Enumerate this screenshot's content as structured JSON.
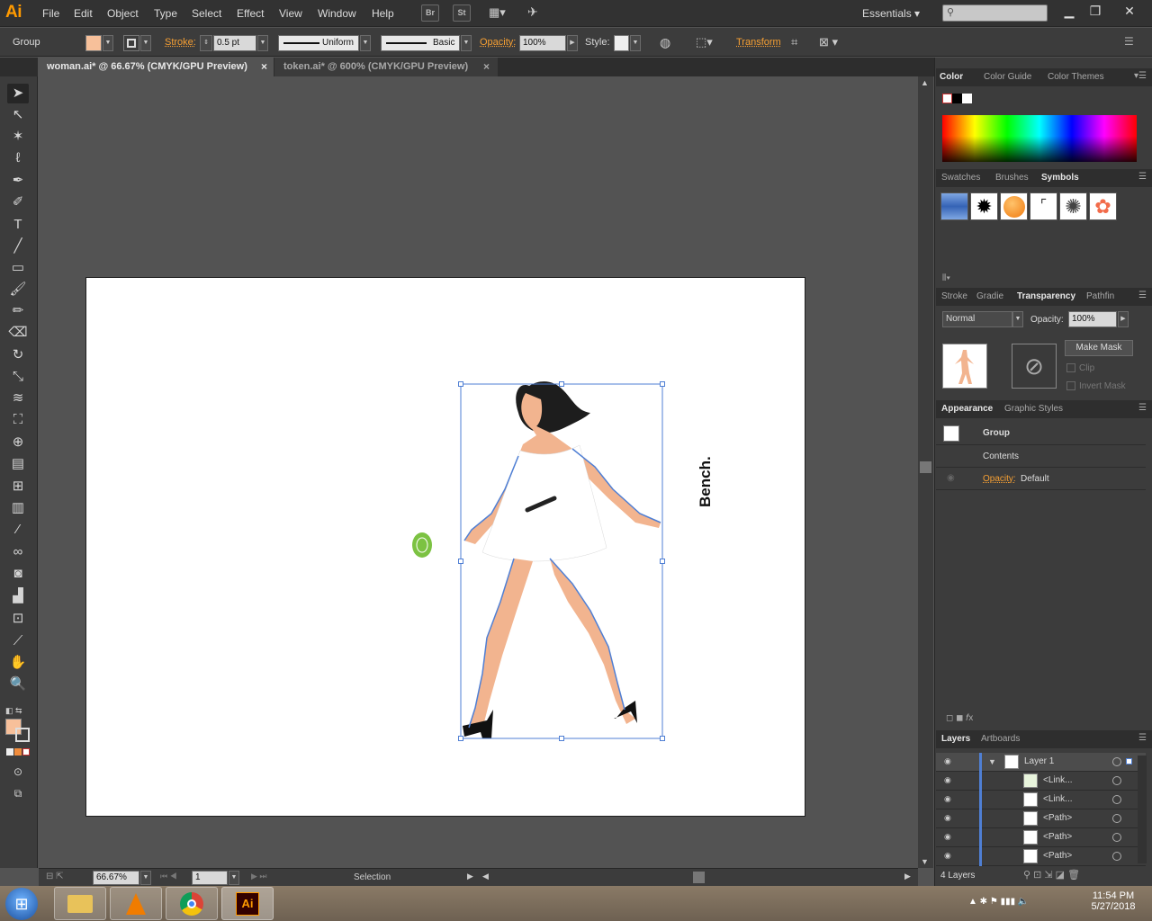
{
  "app": {
    "logo": "Ai"
  },
  "menu": [
    "File",
    "Edit",
    "Object",
    "Type",
    "Select",
    "Effect",
    "View",
    "Window",
    "Help"
  ],
  "toolbar_buttons": {
    "bridge": "Br",
    "stock": "St"
  },
  "workspace": "Essentials",
  "control": {
    "selection_type": "Group",
    "stroke_label": "Stroke:",
    "stroke_weight": "0.5 pt",
    "profile": "Uniform",
    "brush": "Basic",
    "opacity_label": "Opacity:",
    "opacity_value": "100%",
    "style_label": "Style:",
    "transform_label": "Transform",
    "fill_color": "#f7c09a"
  },
  "tabs": [
    {
      "label": "woman.ai* @ 66.67% (CMYK/GPU Preview)",
      "active": true
    },
    {
      "label": "token.ai* @ 600% (CMYK/GPU Preview)",
      "active": false
    }
  ],
  "artwork": {
    "bench_text": "Bench."
  },
  "status": {
    "zoom": "66.67%",
    "artboard": "1",
    "tool": "Selection"
  },
  "panels": {
    "color": {
      "tabs": [
        "Color",
        "Color Guide",
        "Color Themes"
      ]
    },
    "swatches": {
      "tabs": [
        "Swatches",
        "Brushes",
        "Symbols"
      ]
    },
    "transparency": {
      "tabs": [
        "Stroke",
        "Gradie",
        "Transparency",
        "Pathfin"
      ],
      "blend_mode": "Normal",
      "opacity_label": "Opacity:",
      "opacity_value": "100%",
      "make_mask": "Make Mask",
      "clip": "Clip",
      "invert_mask": "Invert Mask"
    },
    "appearance": {
      "tabs": [
        "Appearance",
        "Graphic Styles"
      ],
      "target": "Group",
      "contents": "Contents",
      "opacity_label": "Opacity:",
      "opacity_value": "Default"
    },
    "layers": {
      "tabs": [
        "Layers",
        "Artboards"
      ],
      "rows": [
        {
          "name": "Layer 1"
        },
        {
          "name": "<Link..."
        },
        {
          "name": "<Link..."
        },
        {
          "name": "<Path>"
        },
        {
          "name": "<Path>"
        },
        {
          "name": "<Path>"
        }
      ],
      "count": "4 Layers"
    }
  },
  "clock": {
    "time": "11:54 PM",
    "date": "5/27/2018"
  }
}
